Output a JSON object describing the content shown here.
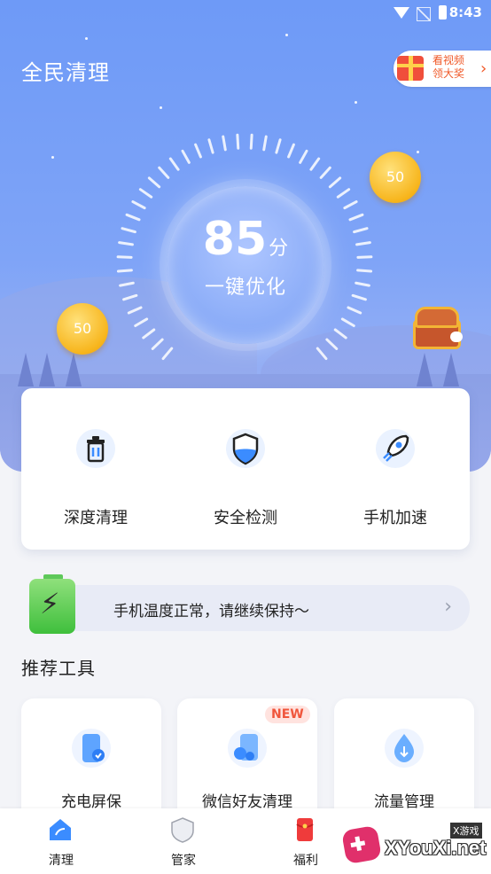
{
  "status_bar": {
    "time": "8:43"
  },
  "header": {
    "title": "全民清理",
    "reward_button": {
      "label": "看视频\n领大奖"
    }
  },
  "score": {
    "value": "85",
    "unit": "分",
    "action": "一键优化"
  },
  "coins": [
    {
      "value": "50"
    },
    {
      "value": "50"
    }
  ],
  "quick_actions": [
    {
      "label": "深度清理",
      "icon": "trash-bin-icon"
    },
    {
      "label": "安全检测",
      "icon": "shield-icon"
    },
    {
      "label": "手机加速",
      "icon": "rocket-icon"
    }
  ],
  "temperature_banner": {
    "text": "手机温度正常，请继续保持～",
    "icon": "battery-bolt-icon"
  },
  "tools_section": {
    "title": "推荐工具",
    "items": [
      {
        "label": "充电屏保",
        "icon": "charge-phone-icon",
        "badge": ""
      },
      {
        "label": "微信好友清理",
        "icon": "wechat-clean-icon",
        "badge": "NEW"
      },
      {
        "label": "流量管理",
        "icon": "data-drop-icon",
        "badge": ""
      }
    ]
  },
  "bottom_nav": [
    {
      "label": "清理",
      "icon": "clean-house-icon",
      "active": true
    },
    {
      "label": "管家",
      "icon": "shield-nav-icon",
      "active": false
    },
    {
      "label": "福利",
      "icon": "red-envelope-icon",
      "active": false
    }
  ],
  "watermark": {
    "text": "XYouXi.net",
    "small": "X游戏"
  },
  "colors": {
    "hero": "#7fa4f7",
    "accent": "#4a86f0",
    "badge": "#f0563c"
  }
}
